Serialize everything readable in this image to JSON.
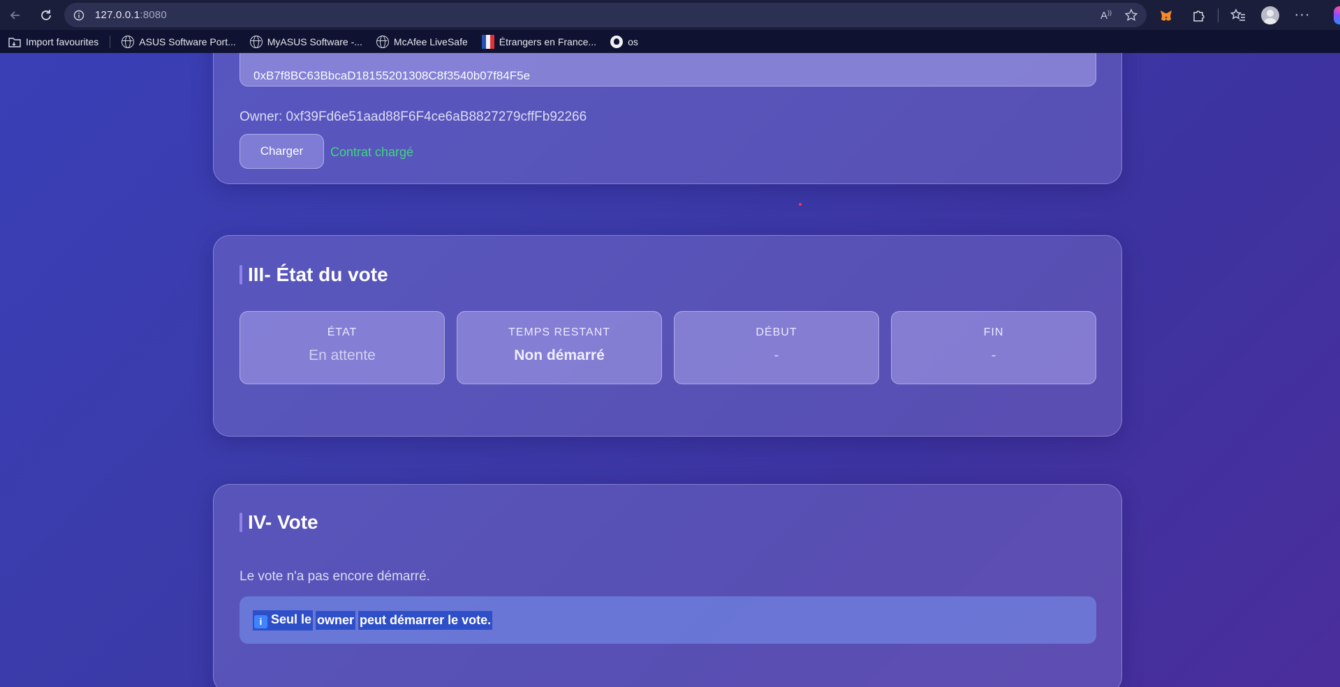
{
  "browser": {
    "url_host": "127.0.0.1",
    "url_port": ":8080",
    "bookmarks": [
      {
        "label": "Import favourites",
        "icon": "import-folder-icon"
      },
      {
        "label": "ASUS Software Port...",
        "icon": "globe-icon"
      },
      {
        "label": "MyASUS Software -...",
        "icon": "globe-icon"
      },
      {
        "label": "McAfee LiveSafe",
        "icon": "globe-icon"
      },
      {
        "label": "Étrangers en France...",
        "icon": "french-flag-icon"
      },
      {
        "label": "os",
        "icon": "github-icon"
      }
    ]
  },
  "contract": {
    "address_value": "0xB7f8BC63BbcaD18155201308C8f3540b07f84F5e",
    "owner_text": "Owner: 0xf39Fd6e51aad88F6F4ce6aB8827279cffFb92266",
    "load_button": "Charger",
    "status": "Contrat chargé",
    "status_color": "#3ed67f"
  },
  "state_section": {
    "title": "III- État du vote",
    "tiles": [
      {
        "label": "ÉTAT",
        "value": "En attente"
      },
      {
        "label": "TEMPS RESTANT",
        "value": "Non démarré"
      },
      {
        "label": "DÉBUT",
        "value": "-"
      },
      {
        "label": "FIN",
        "value": "-"
      }
    ]
  },
  "vote_section": {
    "title": "IV- Vote",
    "message": "Le vote n'a pas encore démarré.",
    "notice_icon": "info-icon",
    "notice_part1": "Seul le",
    "notice_part2": "owner",
    "notice_part3": "peut démarrer le vote."
  },
  "colors": {
    "background_start": "#3a3fb6",
    "background_end": "#4a2e9c",
    "accent_green": "#3ed67f"
  }
}
